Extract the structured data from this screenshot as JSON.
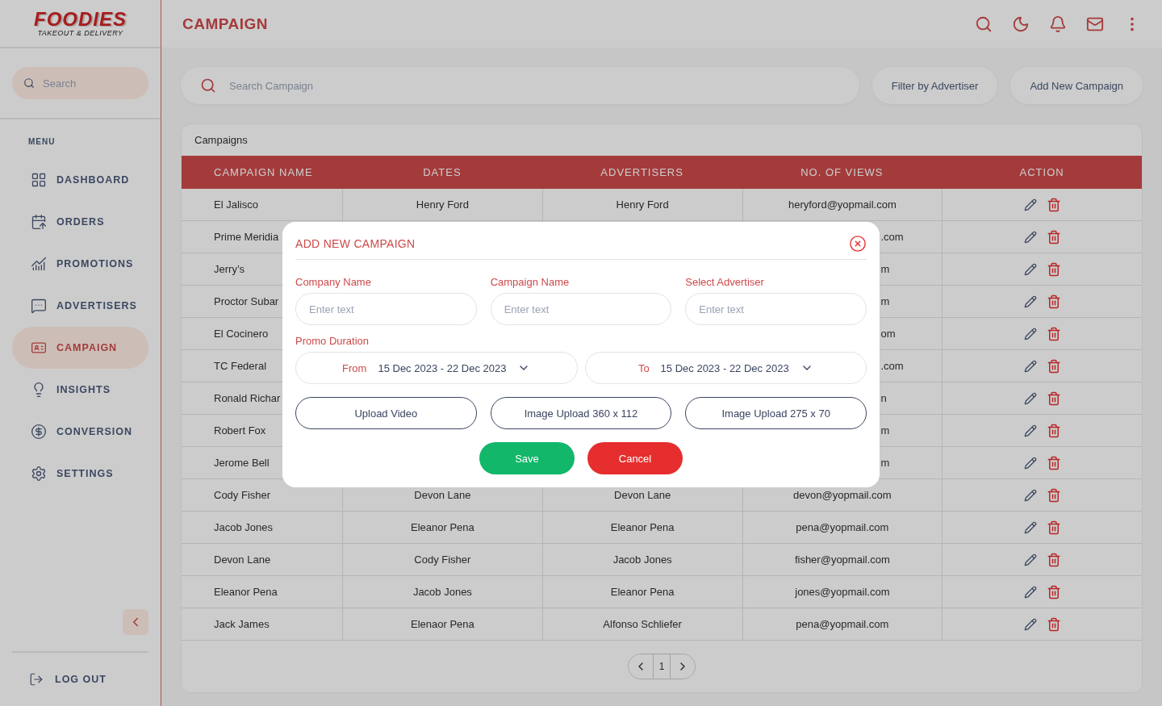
{
  "brand": {
    "name": "FOODIES",
    "tagline": "TAKEOUT & DELIVERY"
  },
  "sidebar": {
    "search_placeholder": "Search",
    "menu_label": "MENU",
    "items": [
      {
        "label": "DASHBOARD",
        "selected": false
      },
      {
        "label": "ORDERS",
        "selected": false
      },
      {
        "label": "PROMOTIONS",
        "selected": false
      },
      {
        "label": "ADVERTISERS",
        "selected": false
      },
      {
        "label": "CAMPAIGN",
        "selected": true
      },
      {
        "label": "INSIGHTS",
        "selected": false
      },
      {
        "label": "CONVERSION",
        "selected": false
      },
      {
        "label": "SETTINGS",
        "selected": false
      }
    ],
    "logout": "LOG OUT"
  },
  "header": {
    "title": "CAMPAIGN"
  },
  "toolbar": {
    "search_placeholder": "Search Campaign",
    "buttons": [
      "Filter by Advertiser",
      "Add New Campaign"
    ]
  },
  "table": {
    "title": "Campaigns",
    "columns": [
      "CAMPAIGN NAME",
      "DATES",
      "ADVERTISERS",
      "NO. OF VIEWS",
      "ACTION"
    ],
    "rows": [
      {
        "campaign_name": "El Jalisco",
        "dates": "Henry Ford",
        "advertisers": "Henry Ford",
        "views": "heryford@yopmail.com"
      },
      {
        "campaign_name": "Prime Meridia",
        "views": ".com"
      },
      {
        "campaign_name": "Jerry’s",
        "views": "m"
      },
      {
        "campaign_name": "Proctor Subar",
        "views": "m"
      },
      {
        "campaign_name": "El Cocinero",
        "views": "om"
      },
      {
        "campaign_name": "TC Federal",
        "views": ".com"
      },
      {
        "campaign_name": "Ronald Richar",
        "views": "n"
      },
      {
        "campaign_name": "Robert Fox",
        "views": "m"
      },
      {
        "campaign_name": "Jerome Bell",
        "views": "m"
      },
      {
        "campaign_name": "Cody Fisher",
        "dates": "Devon Lane",
        "advertisers": "Devon Lane",
        "views": "devon@yopmail.com"
      },
      {
        "campaign_name": "Jacob Jones",
        "dates": "Eleanor Pena",
        "advertisers": "Eleanor Pena",
        "views": "pena@yopmail.com"
      },
      {
        "campaign_name": "Devon Lane",
        "dates": "Cody Fisher",
        "advertisers": "Jacob Jones",
        "views": "fisher@yopmail.com"
      },
      {
        "campaign_name": "Eleanor Pena",
        "dates": "Jacob Jones",
        "advertisers": "Eleanor Pena",
        "views": "jones@yopmail.com"
      },
      {
        "campaign_name": "Jack James",
        "dates": "Elenaor Pena",
        "advertisers": "Alfonso Schliefer",
        "views": "pena@yopmail.com"
      }
    ]
  },
  "pagination": {
    "page": "1"
  },
  "modal": {
    "title": "ADD NEW CAMPAIGN",
    "fields": [
      {
        "label": "Company Name",
        "placeholder": "Enter text"
      },
      {
        "label": "Campaign Name",
        "placeholder": "Enter text"
      },
      {
        "label": "Select Advertiser",
        "placeholder": "Enter text"
      }
    ],
    "promo_duration": {
      "label": "Promo Duration",
      "ranges": [
        {
          "label": "From",
          "value": "15 Dec 2023 - 22 Dec 2023"
        },
        {
          "label": "To",
          "value": "15 Dec 2023 - 22 Dec 2023"
        }
      ]
    },
    "uploads": [
      "Upload Video",
      "Image Upload 360 x 112",
      "Image Upload 275 x 70"
    ],
    "save": "Save",
    "cancel": "Cancel"
  }
}
